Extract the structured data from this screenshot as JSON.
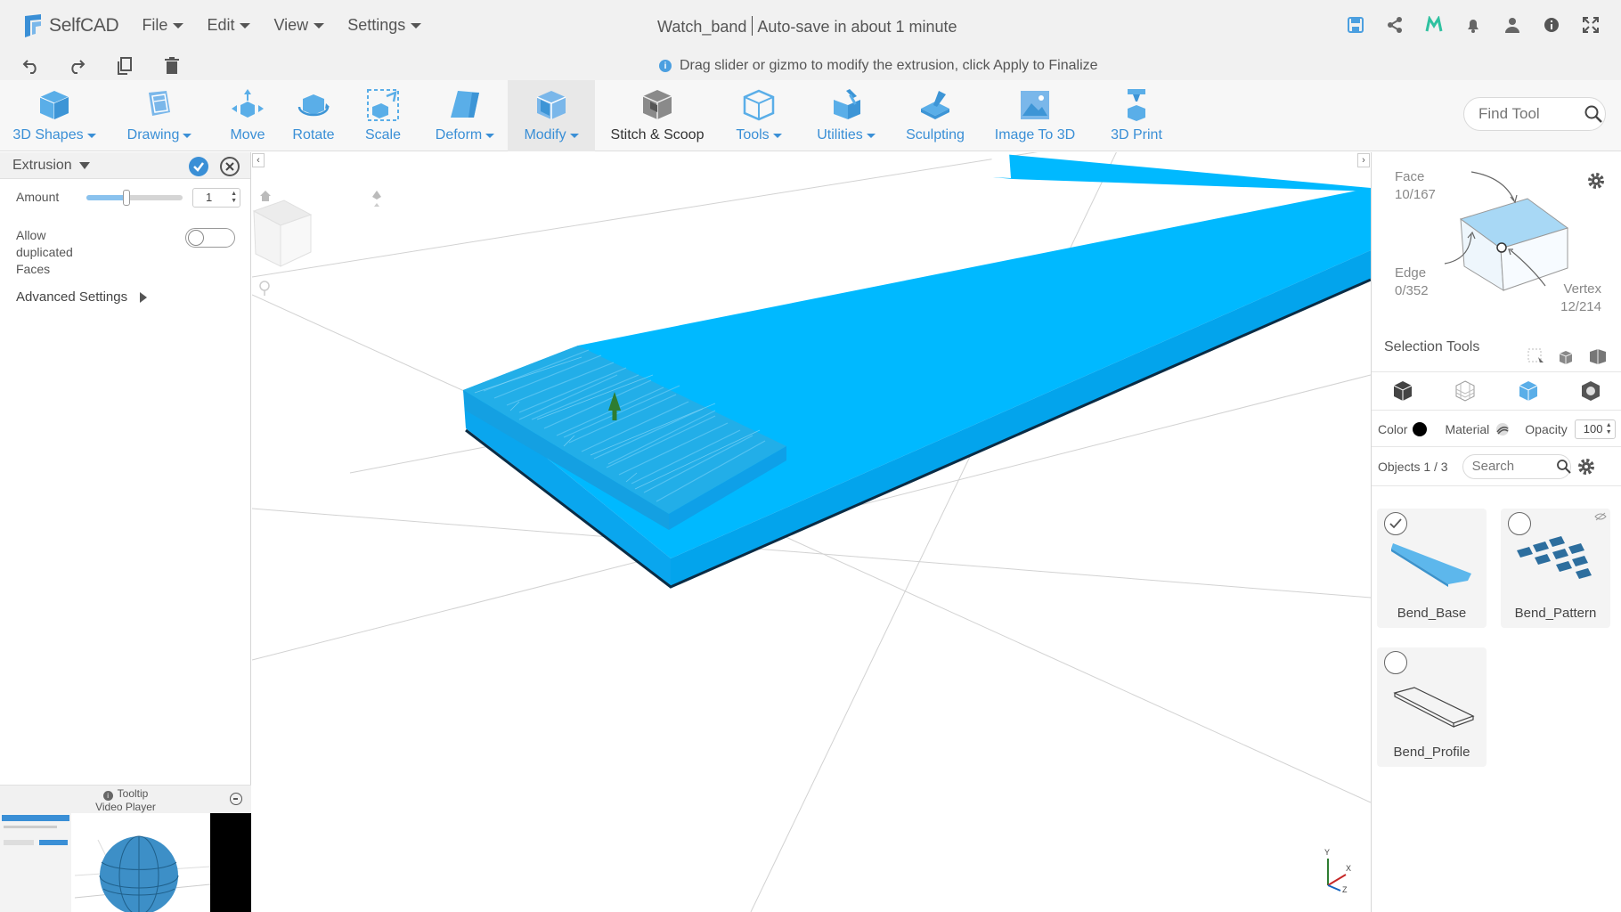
{
  "app": {
    "brand": "SelfCAD",
    "menu": [
      {
        "label": "File"
      },
      {
        "label": "Edit"
      },
      {
        "label": "View"
      },
      {
        "label": "Settings"
      }
    ],
    "doc_name": "Watch_band",
    "autosave": "Auto-save in about 1 minute",
    "top_icons": [
      "save-icon",
      "share-icon",
      "m-logo-icon",
      "bell-icon",
      "user-icon",
      "info-icon",
      "fullscreen-icon"
    ]
  },
  "row2": {
    "hint": "Drag slider or gizmo to modify the extrusion, click Apply to Finalize"
  },
  "toolbar": {
    "tools": [
      {
        "label": "3D Shapes",
        "has_menu": true
      },
      {
        "label": "Drawing",
        "has_menu": true
      },
      {
        "label": "Move",
        "has_menu": false
      },
      {
        "label": "Rotate",
        "has_menu": false
      },
      {
        "label": "Scale",
        "has_menu": false
      },
      {
        "label": "Deform",
        "has_menu": true
      },
      {
        "label": "Modify",
        "has_menu": true
      },
      {
        "label": "Stitch & Scoop",
        "has_menu": false
      },
      {
        "label": "Tools",
        "has_menu": true
      },
      {
        "label": "Utilities",
        "has_menu": true
      },
      {
        "label": "Sculpting",
        "has_menu": false
      },
      {
        "label": "Image To 3D",
        "has_menu": false
      },
      {
        "label": "3D Print",
        "has_menu": false
      }
    ],
    "find_placeholder": "Find Tool"
  },
  "left_panel": {
    "title": "Extrusion",
    "amount_label": "Amount",
    "amount_value": "1",
    "amount_slider_fraction": 0.42,
    "allow_label_1": "Allow",
    "allow_label_2": "duplicated",
    "allow_label_3": "Faces",
    "allow_dup_on": false,
    "advanced_label": "Advanced Settings",
    "tooltip_label": "Tooltip",
    "video_label": "Video Player"
  },
  "right_panel": {
    "face_label": "Face",
    "face_count": "10/167",
    "edge_label": "Edge",
    "edge_count": "0/352",
    "vertex_label": "Vertex",
    "vertex_count": "12/214",
    "selection_tools_label": "Selection Tools",
    "color_label": "Color",
    "color_value": "#000000",
    "material_label": "Material",
    "opacity_label": "Opacity",
    "opacity_value": "100",
    "objects_label": "Objects 1 / 3",
    "search_placeholder": "Search",
    "objects": [
      {
        "name": "Bend_Base",
        "selected": true
      },
      {
        "name": "Bend_Pattern",
        "selected": false
      },
      {
        "name": "Bend_Profile",
        "selected": false
      }
    ]
  },
  "colors": {
    "accent": "#3a8fd6",
    "model_top": "#00b9ff",
    "model_side": "#0aa6ee"
  }
}
